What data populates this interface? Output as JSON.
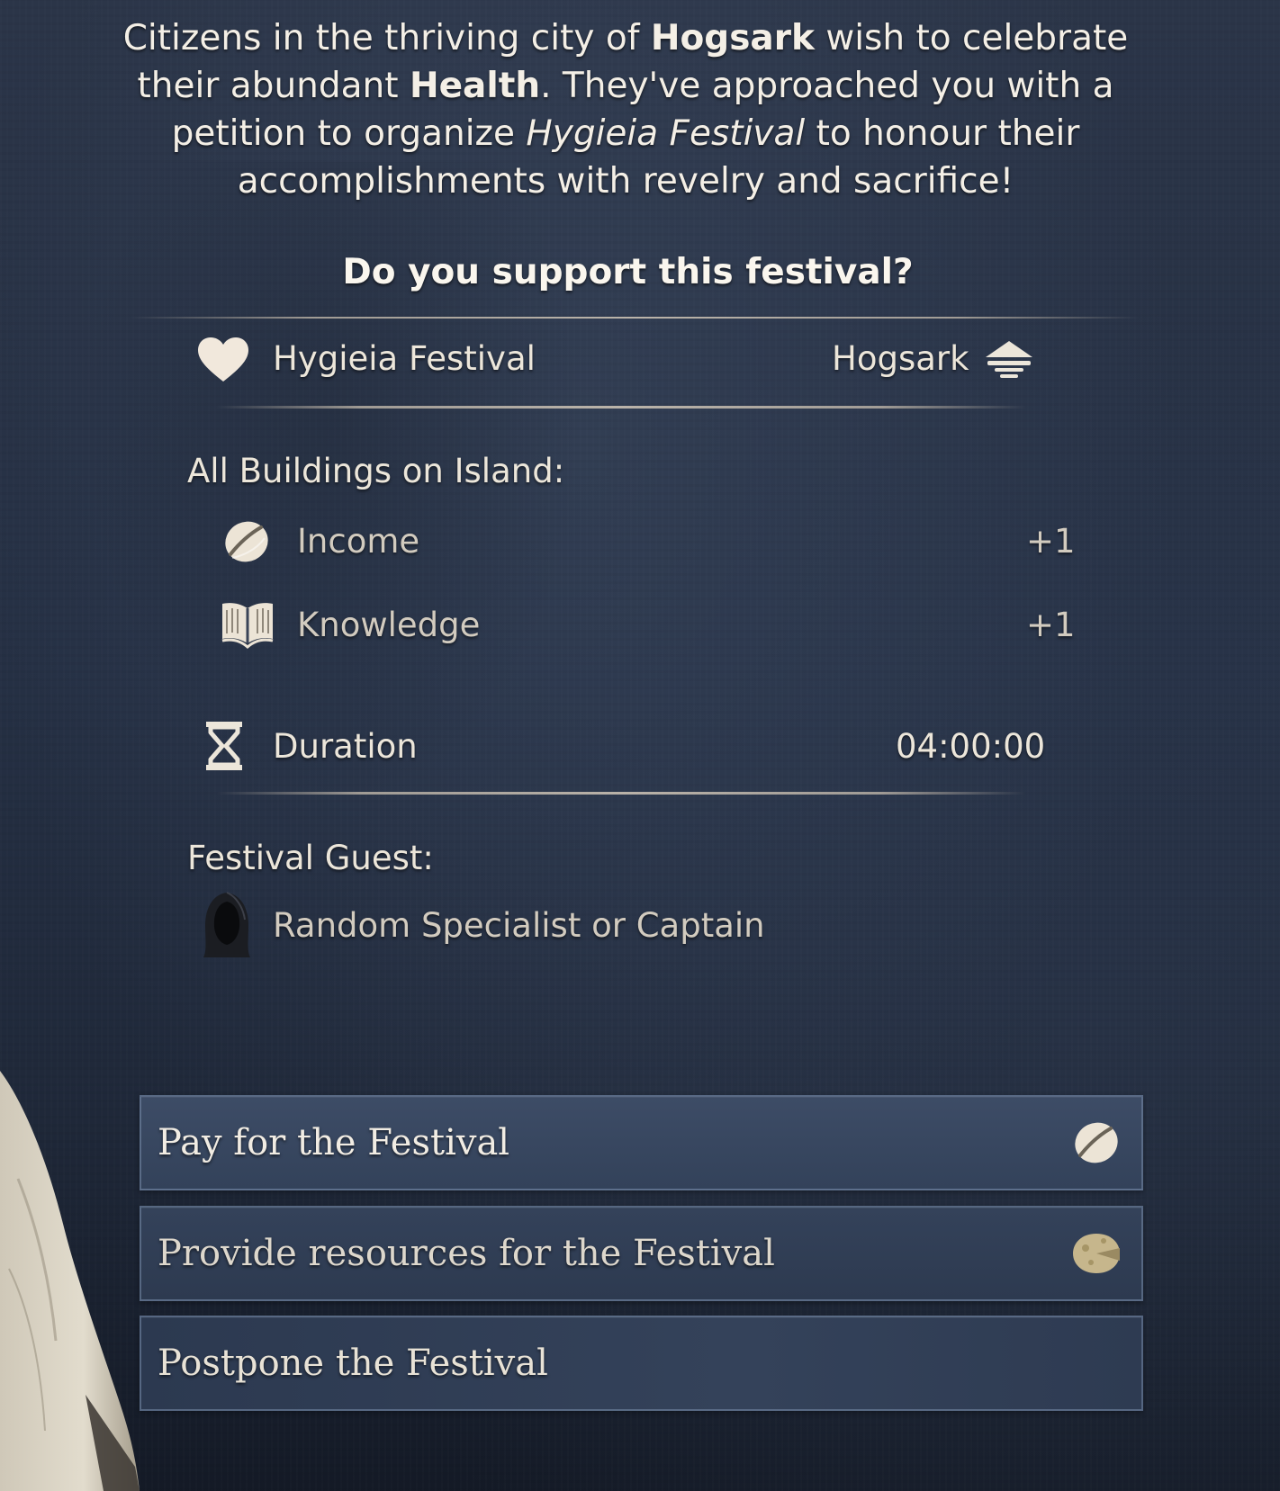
{
  "intro": {
    "p1": "Citizens in the thriving city of ",
    "city": "Hogsark",
    "p2": " wish to celebrate their abundant ",
    "need": "Health",
    "p3": ". They've approached you with a petition to organize ",
    "festival": "Hygieia Festival",
    "p4": " to honour their accomplishments with revelry and sacrifice!"
  },
  "question": "Do you support this festival?",
  "header": {
    "festival_name": "Hygieia Festival",
    "city_name": "Hogsark",
    "festival_icon": "heart-icon",
    "city_icon": "island-icon"
  },
  "effects": {
    "title": "All Buildings on Island:",
    "items": [
      {
        "icon": "coin-icon",
        "label": "Income",
        "value": "+1"
      },
      {
        "icon": "book-icon",
        "label": "Knowledge",
        "value": "+1"
      }
    ]
  },
  "duration": {
    "icon": "hourglass-icon",
    "label": "Duration",
    "value": "04:00:00"
  },
  "guest": {
    "title": "Festival Guest:",
    "icon": "hooded-figure-icon",
    "label": "Random Specialist or Captain"
  },
  "choices": [
    {
      "label": "Pay for the Festival",
      "icon": "coin-icon"
    },
    {
      "label": "Provide resources for the Festival",
      "icon": "cheese-icon"
    },
    {
      "label": "Postpone the Festival",
      "icon": ""
    }
  ],
  "colors": {
    "text": "#f4efe6",
    "button_bg": "#3d4c66",
    "button_border": "#788caa",
    "divider": "#d2c8b9"
  }
}
